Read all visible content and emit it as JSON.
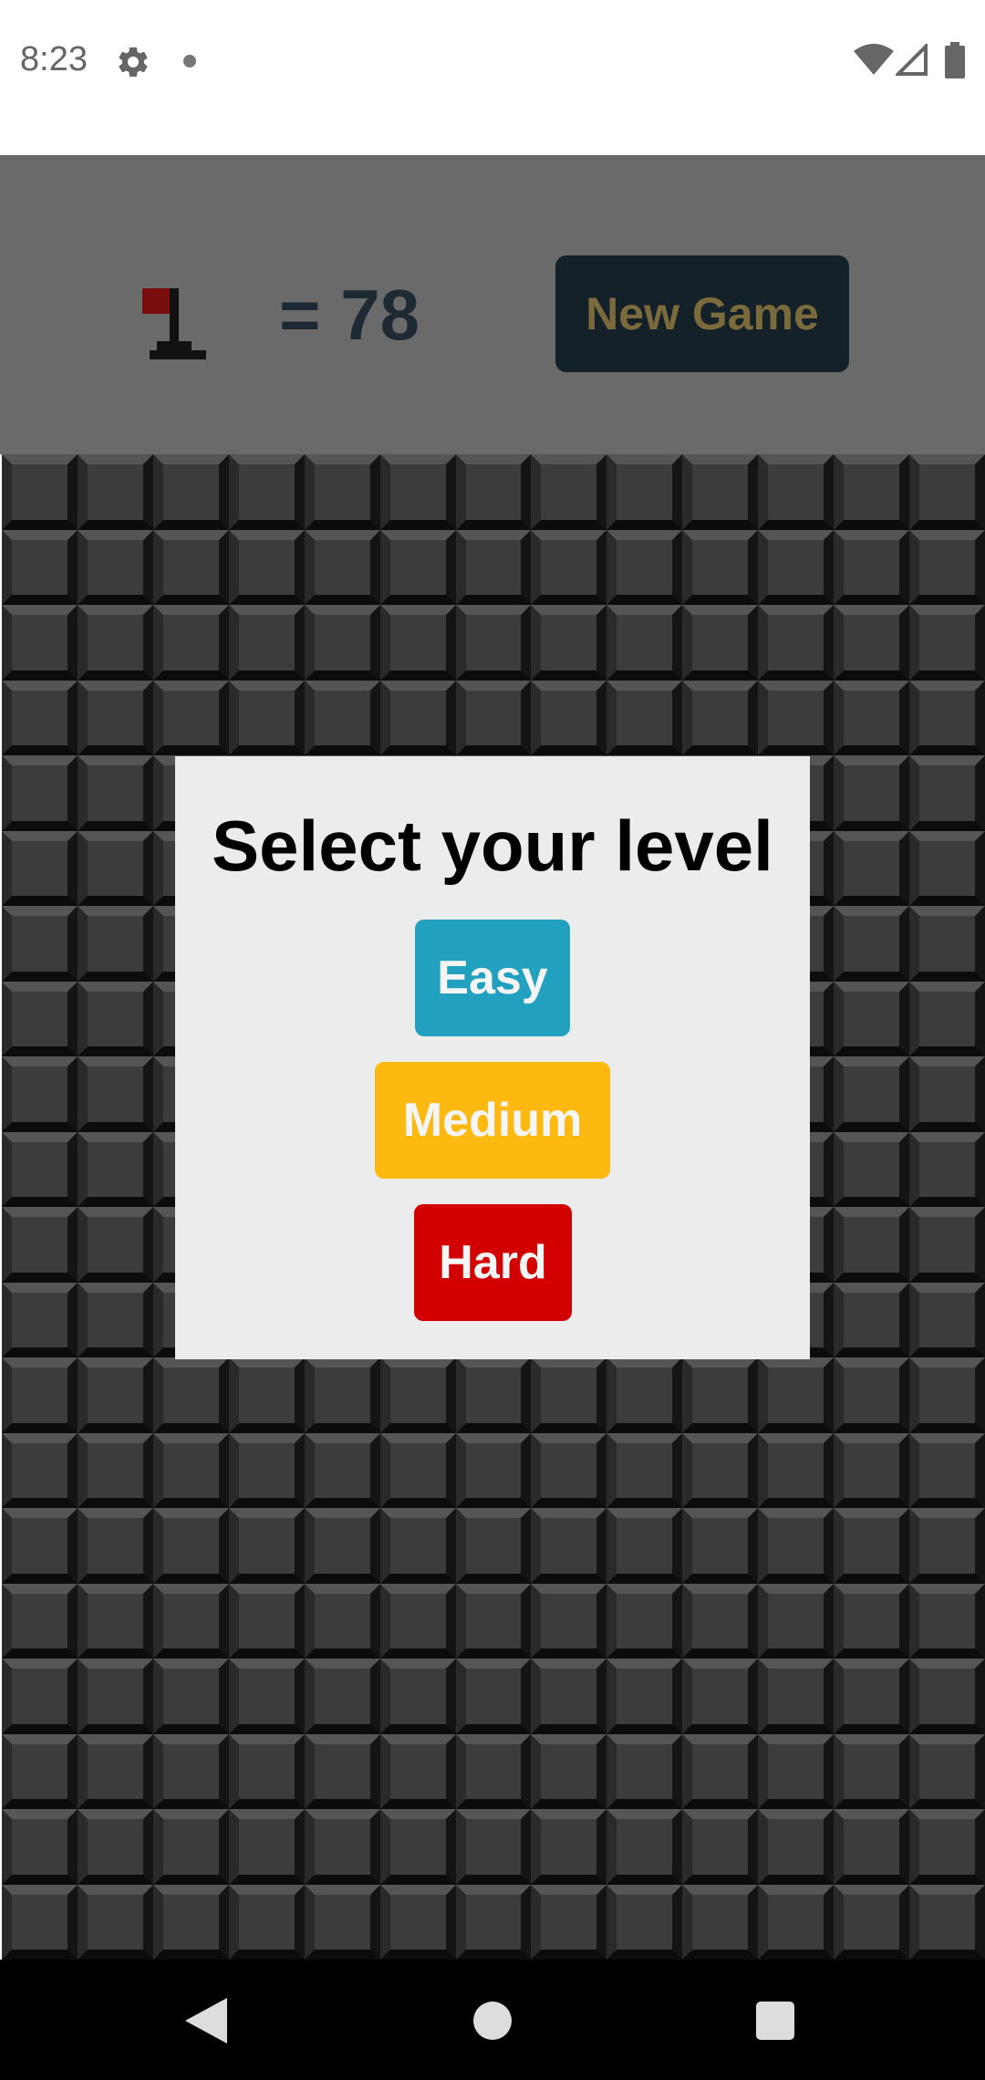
{
  "status_bar": {
    "time": "8:23",
    "icons": [
      "gear-icon",
      "notification-dot-icon",
      "wifi-icon",
      "signal-icon",
      "battery-icon"
    ]
  },
  "header": {
    "flag_icon": "flag-icon",
    "flag_count": "= 78",
    "new_game_label": "New Game"
  },
  "board": {
    "columns": 13,
    "rows": 20,
    "tile_state": "covered"
  },
  "dialog": {
    "title": "Select your level",
    "options": [
      {
        "label": "Easy",
        "color": "#21a0c0"
      },
      {
        "label": "Medium",
        "color": "#fdb90f"
      },
      {
        "label": "Hard",
        "color": "#d20000"
      }
    ]
  },
  "nav_bar": {
    "icons": [
      "back-icon",
      "home-icon",
      "recents-icon"
    ]
  },
  "colors": {
    "header_bg": "#6a6a6a",
    "new_game_bg": "#152129",
    "new_game_text": "#7a6a3c",
    "counter_text": "#1d2a33",
    "flag_red": "#7a0d0d",
    "dialog_bg": "#ececec"
  }
}
